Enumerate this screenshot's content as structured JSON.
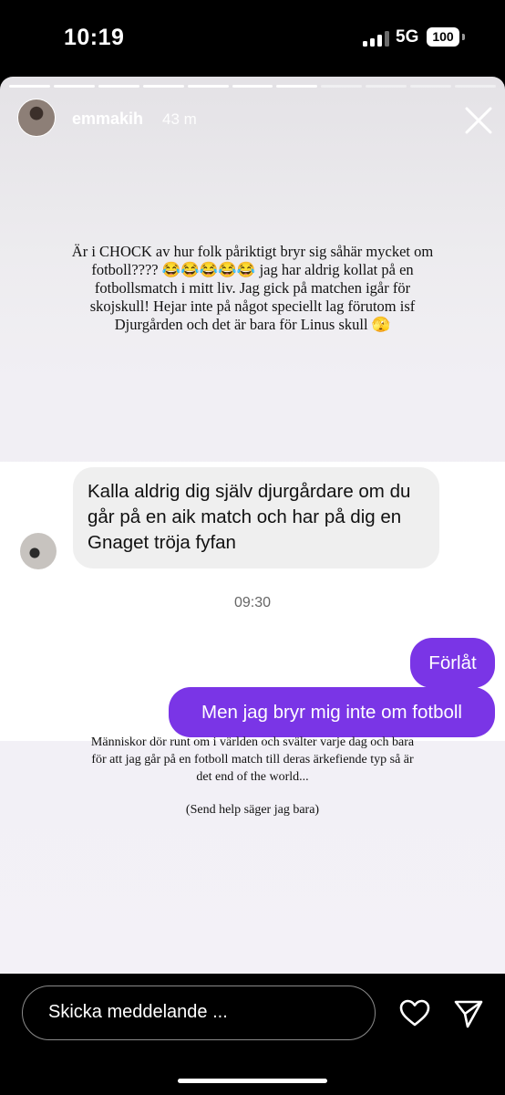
{
  "status_bar": {
    "time": "10:19",
    "network": "5G",
    "battery": "100"
  },
  "story": {
    "username": "emmakih",
    "time_ago": "43 m",
    "progress_segments": 11,
    "progress_viewed": 7,
    "text_top": "Är i CHOCK av hur folk påriktigt bryr sig såhär mycket om fotboll???? 😂😂😂😂😂 jag har aldrig kollat på en fotbollsmatch i mitt liv. Jag gick på matchen igår för skojskull! Hejar inte på något speciellt lag förutom isf Djurgården och det är bara för Linus skull 🫣",
    "text_bottom_1": "Människor dör runt om i världen och svälter varje dag och bara för att jag går på en fotboll match till deras ärkefiende typ så är det end of the world...",
    "text_bottom_2": "(Send help säger jag bara)"
  },
  "chat": {
    "incoming": "Kalla aldrig dig själv djurgårdare om du går på en aik match och har på dig en Gnaget tröja fyfan",
    "timestamp": "09:30",
    "outgoing_1": "Förlåt",
    "outgoing_2": "Men jag bryr mig inte om fotboll"
  },
  "composer": {
    "placeholder": "Skicka meddelande ..."
  },
  "colors": {
    "accent": "#7a35e6",
    "bubble_in": "#efefef",
    "background": "#000000"
  }
}
